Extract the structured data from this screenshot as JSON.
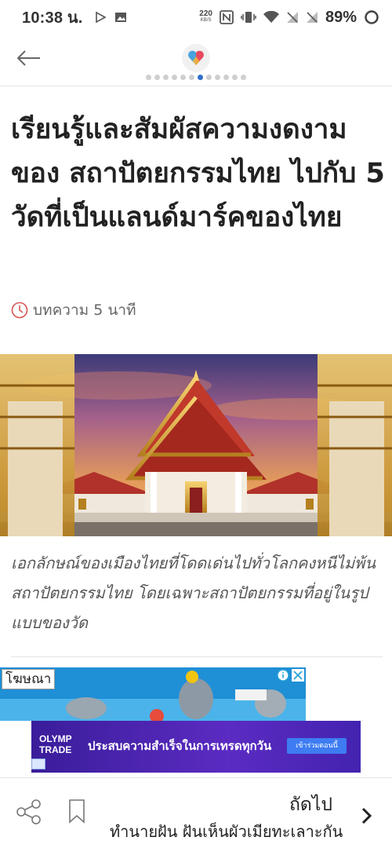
{
  "status_bar": {
    "time": "10:38 น.",
    "net_speed_value": "220",
    "net_speed_unit": "KB/S",
    "battery_percent": "89%",
    "icons": [
      "play-outline-icon",
      "image-icon",
      "nfc-icon",
      "vibrate-icon",
      "wifi-icon",
      "signal-off-icon",
      "signal-off-icon",
      "battery-ring-icon"
    ]
  },
  "header": {
    "back_icon": "arrow-left-icon",
    "logo_icon": "heart-logo-icon",
    "page_dots_total": 12,
    "page_dots_active_index": 6
  },
  "article": {
    "title": "เรียนรู้และสัมผัสความงดงามของ สถาปัตยกรรมไทย ไปกับ 5 วัดที่เป็นแลนด์มาร์คของไทย",
    "read_time": "บทความ 5 นาที",
    "caption": "เอกลักษณ์ของเมืองไทยที่โดดเด่นไปทั่วโลกคงหนีไม่พ้น สถาปัตยกรรมไทย โดยเฉพาะสถาปัตยกรรมที่อยู่ในรูปแบบของวัด"
  },
  "ads": {
    "label": "โฆษณา",
    "olymp_line1": "OLYMP",
    "olymp_line2": "TRADE",
    "banner_text": "ประสบความสำเร็จในการเทรดทุกวัน",
    "banner_button": "เข้าร่วมตอนนี้"
  },
  "bottom_bar": {
    "next_label": "ถัดไป",
    "next_title": "ทำนายฝัน ฝันเห็นผัวเมียทะเลาะกัน"
  },
  "colors": {
    "accent_blue": "#2f6fc7",
    "clock_red": "#d9534f",
    "ad_purple": "#4b25b8"
  }
}
